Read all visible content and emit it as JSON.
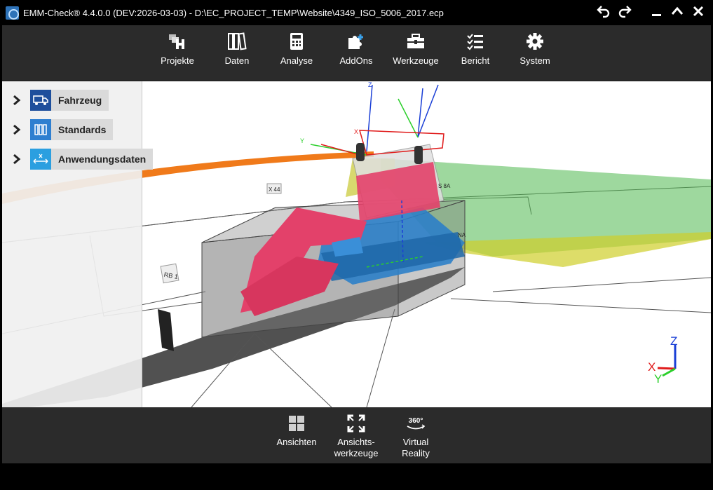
{
  "window": {
    "title": "EMM-Check® 4.4.0.0 (DEV:2026-03-03)  - D:\\EC_PROJECT_TEMP\\Website\\4349_ISO_5006_2017.ecp"
  },
  "toolbar": {
    "items": [
      {
        "label": "Projekte",
        "icon": "projects-icon"
      },
      {
        "label": "Daten",
        "icon": "data-binders-icon"
      },
      {
        "label": "Analyse",
        "icon": "calculator-icon"
      },
      {
        "label": "AddOns",
        "icon": "puzzle-icon"
      },
      {
        "label": "Werkzeuge",
        "icon": "toolbox-icon"
      },
      {
        "label": "Bericht",
        "icon": "checklist-icon"
      },
      {
        "label": "System",
        "icon": "gear-icon"
      }
    ]
  },
  "sidepanel": {
    "items": [
      {
        "label": "Fahrzeug",
        "icon": "truck-icon",
        "color": "#1e4f9c"
      },
      {
        "label": "Standards",
        "icon": "binders-icon",
        "color": "#2e7fd0"
      },
      {
        "label": "Anwendungsdaten",
        "icon": "xyz-arrows-icon",
        "color": "#2b9fe0"
      }
    ]
  },
  "scene": {
    "labels": {
      "rb": "RB 1",
      "x": "X",
      "y": "Y",
      "z": "Z",
      "tag1": "X 44",
      "tag2": "S 8A",
      "tag3": "NA"
    }
  },
  "axes_gizmo": {
    "x": "X",
    "y": "Y",
    "z": "Z",
    "x_color": "#e01b1b",
    "y_color": "#2bcf2b",
    "z_color": "#1a3fd6"
  },
  "bottombar": {
    "items": [
      {
        "label": "Ansichten",
        "icon": "grid-views-icon"
      },
      {
        "label": "Ansichts-\nwerkzeuge",
        "line1": "Ansichts-",
        "line2": "werkzeuge",
        "icon": "expand-icon"
      },
      {
        "label": "Virtual Reality",
        "line1": "Virtual",
        "line2": "Reality",
        "badge": "360°",
        "icon": "vr-360-icon"
      }
    ]
  }
}
